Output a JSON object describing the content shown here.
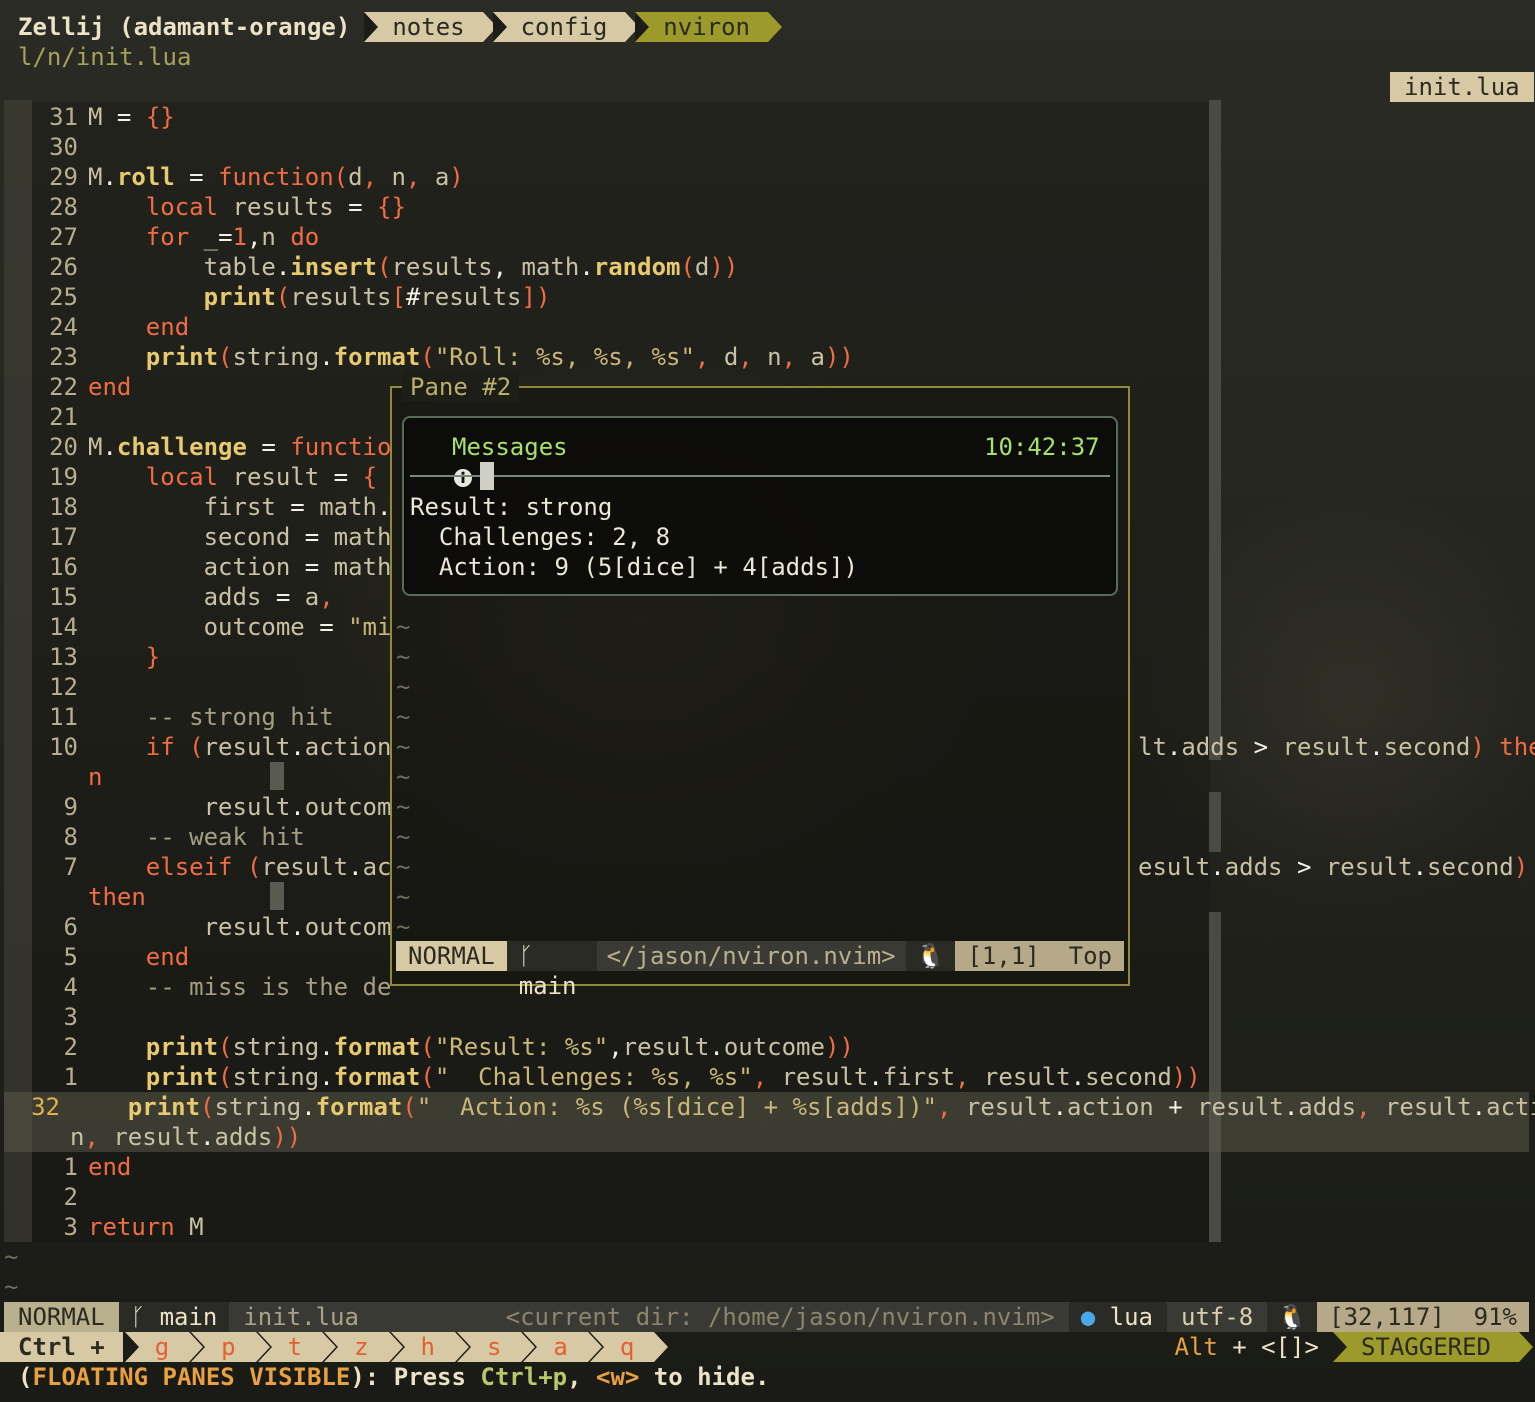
{
  "zellij": {
    "session": "Zellij (adamant-orange)",
    "tabs": [
      "notes",
      "config",
      "nviron"
    ],
    "active_tab": "nviron"
  },
  "path": "l/n/init.lua",
  "winbar": "init.lua",
  "code_lines": [
    {
      "n": "31",
      "html": "<span class='id'>M</span> <span class='op'>=</span> <span class='nm'>{}</span>"
    },
    {
      "n": "30",
      "html": ""
    },
    {
      "n": "29",
      "html": "<span class='id'>M</span><span class='op'>.</span><span class='fn'>roll</span> <span class='op'>=</span> <span class='kw'>function</span><span class='nm'>(</span><span class='id'>d</span><span class='nm'>,</span> <span class='id'>n</span><span class='nm'>,</span> <span class='id'>a</span><span class='nm'>)</span>"
    },
    {
      "n": "28",
      "html": "    <span class='kw'>local</span> <span class='id'>results</span> <span class='op'>=</span> <span class='nm'>{}</span>"
    },
    {
      "n": "27",
      "html": "    <span class='kw'>for</span> <span class='id'>_</span><span class='op'>=</span><span class='nm'>1</span><span class='op'>,</span><span class='id'>n</span> <span class='kw'>do</span>"
    },
    {
      "n": "26",
      "html": "        <span class='id'>table</span><span class='op'>.</span><span class='fn'>insert</span><span class='nm'>(</span><span class='id'>results</span><span class='op'>,</span> <span class='id'>math</span><span class='op'>.</span><span class='fn'>random</span><span class='nm'>(</span><span class='id'>d</span><span class='nm'>))</span>"
    },
    {
      "n": "25",
      "html": "        <span class='fn'>print</span><span class='nm'>(</span><span class='id'>results</span><span class='nm'>[</span><span class='op'>#</span><span class='id'>results</span><span class='nm'>])</span>"
    },
    {
      "n": "24",
      "html": "    <span class='kw'>end</span>"
    },
    {
      "n": "23",
      "html": "    <span class='fn'>print</span><span class='nm'>(</span><span class='id'>string</span><span class='op'>.</span><span class='fn'>format</span><span class='nm'>(</span><span class='st'>\"Roll: %s, %s, %s\"</span><span class='nm'>,</span> <span class='id'>d</span><span class='nm'>,</span> <span class='id'>n</span><span class='nm'>,</span> <span class='id'>a</span><span class='nm'>))</span>"
    },
    {
      "n": "22",
      "html": "<span class='kw'>end</span>"
    },
    {
      "n": "21",
      "html": ""
    },
    {
      "n": "20",
      "html": "<span class='id'>M</span><span class='op'>.</span><span class='fn'>challenge</span> <span class='op'>=</span> <span class='kw'>functio</span>"
    },
    {
      "n": "19",
      "html": "    <span class='kw'>local</span> <span class='id'>result</span> <span class='op'>=</span> <span class='nm'>{</span>"
    },
    {
      "n": "18",
      "html": "        <span class='id'>first</span> <span class='op'>=</span> <span class='id'>math</span><span class='op'>.</span>"
    },
    {
      "n": "17",
      "html": "        <span class='id'>second</span> <span class='op'>=</span> <span class='id'>math</span>"
    },
    {
      "n": "16",
      "html": "        <span class='id'>action</span> <span class='op'>=</span> <span class='id'>math</span>"
    },
    {
      "n": "15",
      "html": "        <span class='id'>adds</span> <span class='op'>=</span> <span class='id'>a</span><span class='nm'>,</span>"
    },
    {
      "n": "14",
      "html": "        <span class='id'>outcome</span> <span class='op'>=</span> <span class='st'>\"mi</span>"
    },
    {
      "n": "13",
      "html": "    <span class='nm'>}</span>"
    },
    {
      "n": "12",
      "html": ""
    },
    {
      "n": "11",
      "html": "    <span class='cm'>-- strong hit</span>"
    },
    {
      "n": "10",
      "html": "    <span class='kw'>if</span> <span class='nm'>(</span><span class='id'>result</span><span class='op'>.</span><span class='id'>action</span>"
    },
    {
      "n": "",
      "html": "<span class='kw'>n</span>"
    },
    {
      "n": "9",
      "html": "        <span class='id'>result</span><span class='op'>.</span><span class='id'>outcom</span>"
    },
    {
      "n": "8",
      "html": "    <span class='cm'>-- weak hit</span>"
    },
    {
      "n": "7",
      "html": "    <span class='kw'>elseif</span> <span class='nm'>(</span><span class='id'>result</span><span class='op'>.</span><span class='id'>ac</span>"
    },
    {
      "n": "",
      "html": "<span class='kw'>then</span>"
    },
    {
      "n": "6",
      "html": "        <span class='id'>result</span><span class='op'>.</span><span class='id'>outcom</span>"
    },
    {
      "n": "5",
      "html": "    <span class='kw'>end</span>"
    },
    {
      "n": "4",
      "html": "    <span class='cm'>-- miss is the de</span>"
    },
    {
      "n": "3",
      "html": ""
    },
    {
      "n": "2",
      "html": "    <span class='fn'>print</span><span class='nm'>(</span><span class='id'>string</span><span class='op'>.</span><span class='fn'>format</span><span class='nm'>(</span><span class='st'>\"Result: %s\"</span><span class='op'>,</span><span class='id'>result</span><span class='op'>.</span><span class='id'>outcome</span><span class='nm'>))</span>"
    },
    {
      "n": "1",
      "html": "    <span class='fn'>print</span><span class='nm'>(</span><span class='id'>string</span><span class='op'>.</span><span class='fn'>format</span><span class='nm'>(</span><span class='st'>\"  Challenges: %s, %s\"</span><span class='nm'>,</span> <span class='id'>result</span><span class='op'>.</span><span class='id'>first</span><span class='nm'>,</span> <span class='id'>result</span><span class='op'>.</span><span class='id'>second</span><span class='nm'>))</span>"
    },
    {
      "n": "32",
      "cur": true,
      "html": "    <span class='fn'>print</span><span class='nm'>(</span><span class='id'>string</span><span class='op'>.</span><span class='fn'>format</span><span class='nm'>(</span><span class='st'>\"  Action: %s (%s[dice] + %s[adds])\"</span><span class='nm'>,</span> <span class='id'>result</span><span class='op'>.</span><span class='id'>action</span> <span class='op'>+</span> <span class='id'>result</span><span class='op'>.</span><span class='id'>adds</span><span class='nm'>,</span> <span class='id'>result</span><span class='op'>.</span><span class='id'>actio</span>"
    },
    {
      "n": "",
      "cur": true,
      "html": "<span class='id'>n</span><span class='nm'>,</span> <span class='id'>result</span><span class='op'>.</span><span class='id'>adds</span><span class='nm'>))</span>"
    },
    {
      "n": "1",
      "html": "<span class='kw'>end</span>"
    },
    {
      "n": "2",
      "html": ""
    },
    {
      "n": "3",
      "html": "<span class='kw'>return</span> <span class='id'>M</span>"
    }
  ],
  "right_fragments": {
    "line10": "<span class='id'>lt</span><span class='op'>.</span><span class='id'>adds</span> <span class='op'>&gt;</span> <span class='id'>result</span><span class='op'>.</span><span class='id'>second</span><span class='nm'>)</span> <span class='kw'>the</span>",
    "line7": "<span class='id'>esult</span><span class='op'>.</span><span class='id'>adds</span> <span class='op'>&gt;</span> <span class='id'>result</span><span class='op'>.</span><span class='id'>second</span><span class='nm'>)</span>"
  },
  "float": {
    "title": "Pane #2",
    "message_title": "Messages",
    "time": "10:42:37",
    "lines": [
      "Result: strong",
      "  Challenges: 2, 8",
      "  Action: 9 (5[dice] + 4[adds])"
    ],
    "status": {
      "mode": "NORMAL",
      "branch": "main",
      "path": "</jason/nviron.nvim>",
      "pos": "[1,1]",
      "scroll": "Top"
    }
  },
  "statusline": {
    "mode": "NORMAL",
    "branch": "main",
    "file": "init.lua",
    "dir": "<current dir: /home/jason/nviron.nvim>",
    "lang": "lua",
    "encoding": "utf-8",
    "pos": "[32,117]",
    "percent": "91%"
  },
  "keybar": {
    "ctrl": "Ctrl +",
    "keys": [
      "g",
      "p",
      "t",
      "z",
      "h",
      "s",
      "a",
      "q"
    ],
    "alt_prefix": "Alt",
    "alt_plus": " + ",
    "alt_keys": "<[]>",
    "layout": "STAGGERED"
  },
  "hint": {
    "open": "(",
    "label": "FLOATING PANES VISIBLE",
    "close": "): Press ",
    "combo": "Ctrl+p",
    "sep": ", ",
    "w": "<w>",
    "tail": " to hide."
  },
  "colors": {
    "accent": "#9b9a2a",
    "tab": "#d8c9a5",
    "keyword": "#f06c43",
    "func": "#e7c96f"
  }
}
